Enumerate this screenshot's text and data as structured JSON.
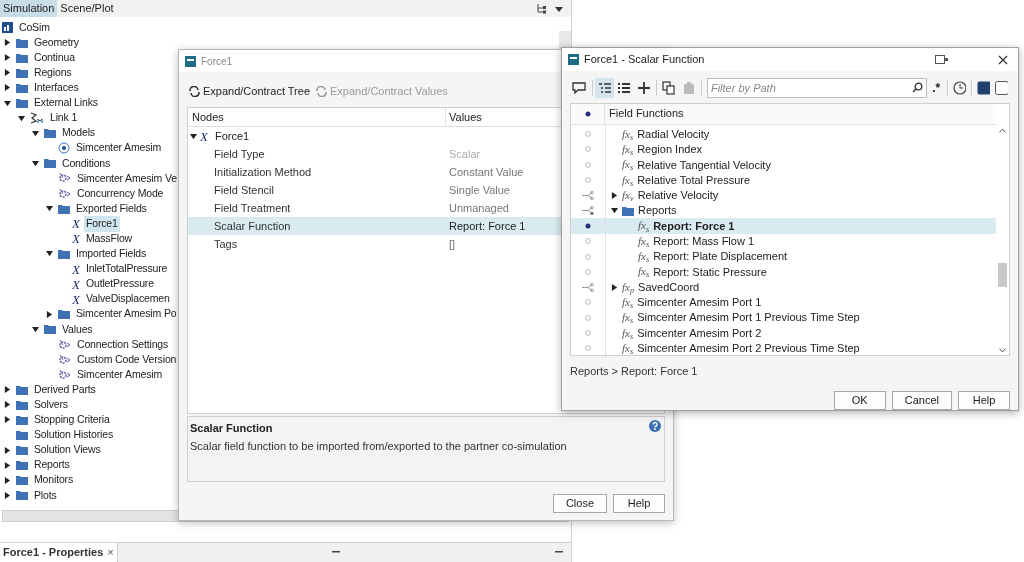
{
  "left_panel": {
    "tabs": [
      {
        "label": "Simulation",
        "selected": true
      },
      {
        "label": "Scene/Plot",
        "selected": false
      }
    ],
    "tree": [
      {
        "kind": "root",
        "label": "CoSim",
        "selected": false,
        "children": [
          {
            "kind": "folder",
            "label": "Geometry",
            "expanded": false,
            "selected": false
          },
          {
            "kind": "folder",
            "label": "Continua",
            "expanded": false,
            "selected": false
          },
          {
            "kind": "folder",
            "label": "Regions",
            "expanded": false,
            "selected": false
          },
          {
            "kind": "folder",
            "label": "Interfaces",
            "expanded": false,
            "selected": false
          },
          {
            "kind": "folder",
            "label": "External Links",
            "expanded": true,
            "selected": false,
            "children": [
              {
                "kind": "link",
                "label": "Link 1",
                "expanded": true,
                "selected": false,
                "children": [
                  {
                    "kind": "folder",
                    "label": "Models",
                    "expanded": true,
                    "selected": false,
                    "children": [
                      {
                        "kind": "model",
                        "label": "Simcenter Amesim",
                        "selected": false
                      }
                    ]
                  },
                  {
                    "kind": "folder",
                    "label": "Conditions",
                    "expanded": true,
                    "selected": false,
                    "children": [
                      {
                        "kind": "setting",
                        "label": "Simcenter Amesim Ve",
                        "selected": false
                      },
                      {
                        "kind": "setting",
                        "label": "Concurrency Mode",
                        "selected": false
                      },
                      {
                        "kind": "folder",
                        "label": "Exported Fields",
                        "expanded": true,
                        "selected": false,
                        "children": [
                          {
                            "kind": "field",
                            "glyph": "X",
                            "label": "Force1",
                            "selected": true
                          },
                          {
                            "kind": "field",
                            "glyph": "X",
                            "label": "MassFlow",
                            "selected": false
                          }
                        ]
                      },
                      {
                        "kind": "folder",
                        "label": "Imported Fields",
                        "expanded": true,
                        "selected": false,
                        "children": [
                          {
                            "kind": "field",
                            "glyph": "X",
                            "label": "InletTotalPressure",
                            "selected": false
                          },
                          {
                            "kind": "field",
                            "glyph": "X",
                            "label": "OutletPressure",
                            "selected": false
                          },
                          {
                            "kind": "field",
                            "glyph": "X",
                            "label": "ValveDisplacemen",
                            "selected": false
                          }
                        ]
                      },
                      {
                        "kind": "folder",
                        "label": "Simcenter Amesim Po",
                        "expanded": false,
                        "selected": false
                      }
                    ]
                  },
                  {
                    "kind": "folder",
                    "label": "Values",
                    "expanded": true,
                    "selected": false,
                    "children": [
                      {
                        "kind": "setting",
                        "label": "Connection Settings",
                        "selected": false
                      },
                      {
                        "kind": "setting",
                        "label": "Custom Code Version",
                        "selected": false
                      },
                      {
                        "kind": "setting",
                        "label": "Simcenter Amesim",
                        "selected": false
                      }
                    ]
                  }
                ]
              }
            ]
          },
          {
            "kind": "folder",
            "label": "Derived Parts",
            "expanded": false,
            "selected": false
          },
          {
            "kind": "folder",
            "label": "Solvers",
            "expanded": false,
            "selected": false
          },
          {
            "kind": "folder",
            "label": "Stopping Criteria",
            "expanded": false,
            "selected": false
          },
          {
            "kind": "folder",
            "label": "Solution Histories",
            "selected": false
          },
          {
            "kind": "folder",
            "label": "Solution Views",
            "expanded": false,
            "selected": false
          },
          {
            "kind": "folder",
            "label": "Reports",
            "expanded": false,
            "selected": false
          },
          {
            "kind": "folder",
            "label": "Monitors",
            "expanded": false,
            "selected": false
          },
          {
            "kind": "folder",
            "label": "Plots",
            "expanded": false,
            "selected": false
          }
        ]
      }
    ]
  },
  "properties_tab": {
    "label": "Force1 - Properties",
    "close": "×"
  },
  "dialog": {
    "title": "Force1",
    "toolbar": [
      {
        "label": "Expand/Contract Tree",
        "disabled": false
      },
      {
        "label": "Expand/Contract Values",
        "disabled": true
      }
    ],
    "columns": [
      "Nodes",
      "Values"
    ],
    "root": {
      "glyph": "X",
      "label": "Force1",
      "expanded": true
    },
    "rows": [
      {
        "name": "Field Type",
        "value": "Scalar",
        "disabled": true,
        "selected": false
      },
      {
        "name": "Initialization Method",
        "value": "Constant Value",
        "disabled": false,
        "selected": false
      },
      {
        "name": "Field Stencil",
        "value": "Single Value",
        "disabled": false,
        "selected": false
      },
      {
        "name": "Field Treatment",
        "value": "Unmanaged",
        "disabled": false,
        "selected": false
      },
      {
        "name": "Scalar Function",
        "value": "Report: Force 1",
        "disabled": false,
        "selected": true
      },
      {
        "name": "Tags",
        "value": "[]",
        "disabled": false,
        "selected": false
      }
    ],
    "description": {
      "title": "Scalar Function",
      "text": "Scalar field function to be imported from/exported to the partner co-simulation"
    },
    "buttons": [
      "Close",
      "Help"
    ]
  },
  "scalar_window": {
    "title": "Force1 - Scalar Function",
    "toolbar": [
      {
        "kind": "comment",
        "selected": false,
        "disabled": false
      },
      {
        "kind": "tree",
        "selected": true,
        "disabled": false
      },
      {
        "kind": "list",
        "selected": false,
        "disabled": false
      },
      {
        "kind": "add",
        "selected": false,
        "disabled": false
      },
      {
        "kind": "copy",
        "selected": false,
        "disabled": false
      },
      {
        "kind": "paste",
        "selected": false,
        "disabled": true
      }
    ],
    "filter": {
      "placeholder": "Filter by Path"
    },
    "regex_button": ".*",
    "column": "Field Functions",
    "rows": [
      {
        "kind": "function",
        "icon": "fx$_{s}$",
        "label": "Radial Velocity",
        "selected": false
      },
      {
        "kind": "function",
        "icon": "fx$_{s}$",
        "label": "Region Index",
        "selected": false
      },
      {
        "kind": "function",
        "icon": "fx$_{s}$",
        "label": "Relative Tangential Velocity",
        "selected": false
      },
      {
        "kind": "function",
        "icon": "fx$_{s}$",
        "label": "Relative Total Pressure",
        "selected": false
      },
      {
        "kind": "group",
        "icon": "fx$_{v}$",
        "label": "Relative Velocity",
        "expanded": false
      },
      {
        "kind": "folder",
        "label": "Reports",
        "expanded": true,
        "children": [
          {
            "kind": "function",
            "icon": "fx$_{s}$",
            "label": "Report: Force 1",
            "selected": true
          },
          {
            "kind": "function",
            "icon": "fx$_{s}$",
            "label": "Report: Mass Flow 1",
            "selected": false
          },
          {
            "kind": "function",
            "icon": "fx$_{s}$",
            "label": "Report: Plate Displacement",
            "selected": false
          },
          {
            "kind": "function",
            "icon": "fx$_{s}$",
            "label": "Report: Static Pressure",
            "selected": false
          }
        ]
      },
      {
        "kind": "group",
        "icon": "fx$_{p}$",
        "label": "SavedCoord",
        "expanded": false
      },
      {
        "kind": "function",
        "icon": "fx$_{s}$",
        "label": "Simcenter Amesim Port 1",
        "selected": false
      },
      {
        "kind": "function",
        "icon": "fx$_{s}$",
        "label": "Simcenter Amesim Port 1 Previous Time Step",
        "selected": false
      },
      {
        "kind": "function",
        "icon": "fx$_{s}$",
        "label": "Simcenter Amesim Port 2",
        "selected": false
      },
      {
        "kind": "function",
        "icon": "fx$_{s}$",
        "label": "Simcenter Amesim Port 2 Previous Time Step",
        "selected": false
      }
    ],
    "path": "Reports > Report: Force 1",
    "buttons": [
      "OK",
      "Cancel",
      "Help"
    ]
  }
}
